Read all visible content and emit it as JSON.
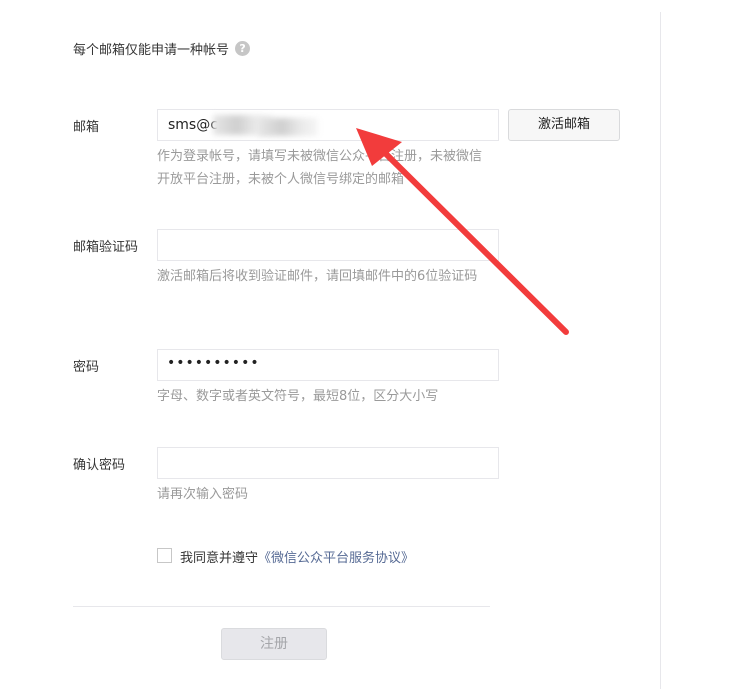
{
  "notice": {
    "text": "每个邮箱仅能申请一种帐号",
    "help_icon": "question-circle-icon",
    "help_glyph": "?"
  },
  "email": {
    "label": "邮箱",
    "value_prefix": "sms@c",
    "activate_button": "激活邮箱",
    "hint": "作为登录帐号，请填写未被微信公众平台注册，未被微信开放平台注册，未被个人微信号绑定的邮箱"
  },
  "code": {
    "label": "邮箱验证码",
    "value": "",
    "hint": "激活邮箱后将收到验证邮件，请回填邮件中的6位验证码"
  },
  "password": {
    "label": "密码",
    "masked_value": "••••••••••",
    "hint": "字母、数字或者英文符号，最短8位，区分大小写"
  },
  "confirm": {
    "label": "确认密码",
    "value": "",
    "hint": "请再次输入密码"
  },
  "agreement": {
    "checked": false,
    "text": "我同意并遵守",
    "link": "《微信公众平台服务协议》"
  },
  "register_button": "注册",
  "colors": {
    "annotation_arrow": "#f23c3c",
    "link": "#576b95",
    "hint": "#9a9a9a"
  }
}
